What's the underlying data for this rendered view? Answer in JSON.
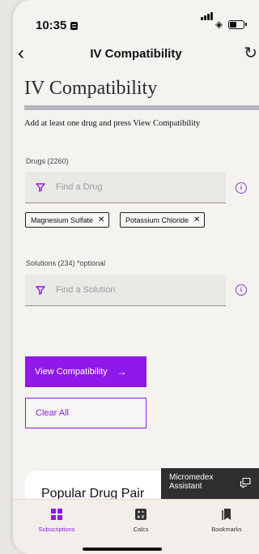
{
  "status_bar": {
    "time": "10:35"
  },
  "navbar": {
    "back_icon": "chevron-left-icon",
    "title": "IV Compatibility",
    "refresh_icon": "refresh-icon"
  },
  "page": {
    "title": "IV Compatibility",
    "instruction": "Add at least one drug and press View Compatibility"
  },
  "drugs": {
    "label": "Drugs (2260)",
    "placeholder": "Find a Drug",
    "selected": [
      {
        "label": "Magnesium Sulfate"
      },
      {
        "label": "Potassium Chloride"
      }
    ]
  },
  "solutions": {
    "label": "Solutions (234) *optional",
    "placeholder": "Find a Solution"
  },
  "actions": {
    "view_label": "View Compatibility",
    "view_arrow": "→",
    "clear_label": "Clear All"
  },
  "card": {
    "title": "Popular Drug Pair Compatibility Search"
  },
  "assistant": {
    "line1": "Micromedex",
    "line2": "Assistant"
  },
  "tabs": [
    {
      "label": "Subscriptions",
      "icon": "grid-icon",
      "active": true
    },
    {
      "label": "Calcs",
      "icon": "calculator-icon",
      "active": false
    },
    {
      "label": "Bookmarks",
      "icon": "bookmarks-icon",
      "active": false
    }
  ],
  "colors": {
    "accent": "#8f19e8",
    "background": "#f5f3ef",
    "assistant_bg": "#2f2f2f"
  }
}
